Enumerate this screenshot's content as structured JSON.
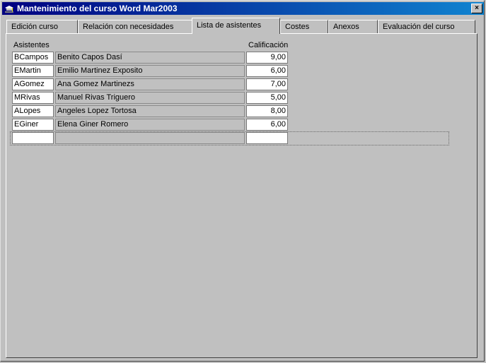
{
  "window": {
    "title": "Mantenimiento del curso Word Mar2003",
    "close_label": "×"
  },
  "tabs": [
    {
      "label": "Edición curso",
      "active": false
    },
    {
      "label": "Relación con necesidades",
      "active": false
    },
    {
      "label": "Lista de asistentes",
      "active": true
    },
    {
      "label": "Costes",
      "active": false
    },
    {
      "label": "Anexos",
      "active": false
    },
    {
      "label": "Evaluación del curso",
      "active": false
    }
  ],
  "grid": {
    "headers": {
      "attendees": "Asistentes",
      "grade": "Calificación"
    },
    "rows": [
      {
        "code": "BCampos",
        "name": "Benito Capos Dasí",
        "grade": "9,00"
      },
      {
        "code": "EMartin",
        "name": "Emilio Martinez Exposito",
        "grade": "6,00"
      },
      {
        "code": "AGomez",
        "name": "Ana Gomez Martinezs",
        "grade": "7,00"
      },
      {
        "code": "MRivas",
        "name": "Manuel Rivas Triguero",
        "grade": "5,00"
      },
      {
        "code": "ALopes",
        "name": "Angeles Lopez Tortosa",
        "grade": "8,00"
      },
      {
        "code": "EGiner",
        "name": "Elena Giner Romero",
        "grade": "6,00"
      }
    ],
    "new_row": {
      "code": "",
      "name": "",
      "grade": ""
    }
  }
}
